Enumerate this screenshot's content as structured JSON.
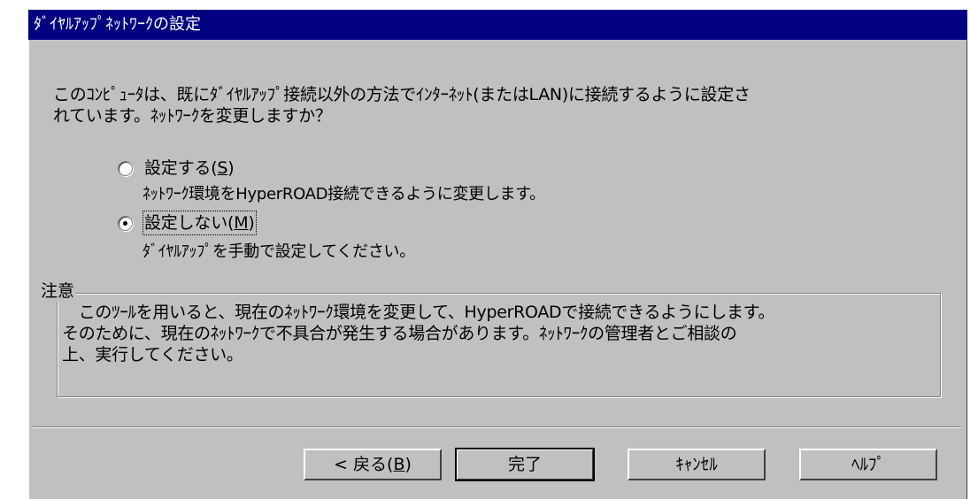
{
  "window": {
    "title": "ﾀﾞｲﾔﾙｱｯﾌﾟﾈｯﾄﾜｰｸの設定"
  },
  "message": {
    "line1": "このｺﾝﾋﾟｭｰﾀは、既にﾀﾞｲﾔﾙｱｯﾌﾟ接続以外の方法でｲﾝﾀｰﾈｯﾄ(またはLAN)に接続するように設定さ",
    "line2": "れています。ﾈｯﾄﾜｰｸを変更しますか？"
  },
  "options": [
    {
      "label": "設定する(",
      "mnemonic": "S",
      "suffix": ")",
      "checked": false,
      "description": "ﾈｯﾄﾜｰｸ環境をHyperROAD接続できるように変更します。"
    },
    {
      "label": "設定しない(",
      "mnemonic": "M",
      "suffix": ")",
      "checked": true,
      "description": "ﾀﾞｲﾔﾙｱｯﾌﾟを手動で設定してください。"
    }
  ],
  "notice": {
    "title": "注意",
    "line1": "　このﾂｰﾙを用いると、現在のﾈｯﾄﾜｰｸ環境を変更して、HyperROADで接続できるようにします。",
    "line2": "そのために、現在のﾈｯﾄﾜｰｸで不具合が発生する場合があります。ﾈｯﾄﾜｰｸの管理者とご相談の",
    "line3": "上、実行してください。"
  },
  "buttons": {
    "back": {
      "label": "< 戻る(",
      "mnemonic": "B",
      "suffix": ")"
    },
    "finish": "完了",
    "cancel": "ｷｬﾝｾﾙ",
    "help": "ﾍﾙﾌﾟ"
  }
}
